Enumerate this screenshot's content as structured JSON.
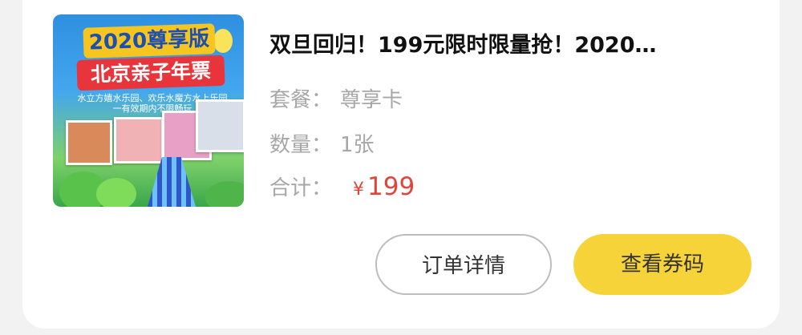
{
  "order": {
    "title": "双旦回归！199元限时限量抢！2020…",
    "package_label": "套餐：",
    "package_value": "尊享卡",
    "quantity_label": "数量：",
    "quantity_value": "1张",
    "total_label": "合计：",
    "currency": "¥",
    "total_value": "199",
    "thumbnail": {
      "headline_1": "2020尊享版",
      "headline_2": "北京亲子年票",
      "subtext": "水立方嬉水乐园、欢乐水魔方水上乐园 一有效期内不限畅玩"
    }
  },
  "actions": {
    "detail_label": "订单详情",
    "code_label": "查看券码"
  },
  "colors": {
    "accent_yellow": "#f6d338",
    "price_red": "#e0443a"
  }
}
